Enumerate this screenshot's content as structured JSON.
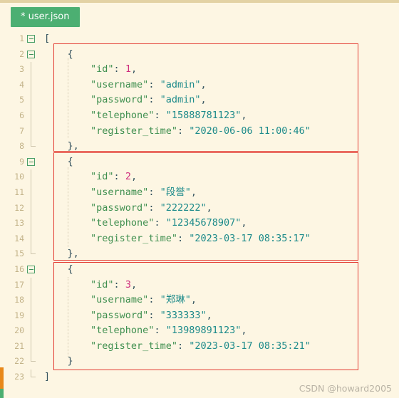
{
  "window": {
    "background_color": "#fdf6e3",
    "top_strip_color": "#e3d2a4"
  },
  "tab_bar": {
    "active_tab": {
      "label": "* user.json",
      "modified_marker": "*",
      "filename": "user.json",
      "background_color": "#4caf72",
      "text_color": "#ffffff"
    }
  },
  "editor": {
    "language": "json",
    "theme": "solarized-light",
    "colors": {
      "key": "#3f8f4f",
      "string": "#1c8a8a",
      "number": "#cf2f7e",
      "punctuation": "#34525e",
      "line_number": "#c3b389",
      "highlight_box": "#e33b32",
      "change_marker_modified": "#e8881a",
      "change_marker_added": "#4caf72"
    },
    "line_numbers": [
      "1",
      "2",
      "3",
      "4",
      "5",
      "6",
      "7",
      "8",
      "9",
      "10",
      "11",
      "12",
      "13",
      "14",
      "15",
      "16",
      "17",
      "18",
      "19",
      "20",
      "21",
      "22",
      "23"
    ],
    "fold_lines": [
      "1",
      "2",
      "9",
      "16"
    ],
    "lines": [
      {
        "n": "1",
        "indent": 0,
        "tokens": [
          {
            "t": "punc",
            "v": "["
          }
        ]
      },
      {
        "n": "2",
        "indent": 1,
        "tokens": [
          {
            "t": "punc",
            "v": "{"
          }
        ]
      },
      {
        "n": "3",
        "indent": 2,
        "tokens": [
          {
            "t": "key",
            "v": "\"id\""
          },
          {
            "t": "colon",
            "v": ": "
          },
          {
            "t": "num",
            "v": "1"
          },
          {
            "t": "punc",
            "v": ","
          }
        ]
      },
      {
        "n": "4",
        "indent": 2,
        "tokens": [
          {
            "t": "key",
            "v": "\"username\""
          },
          {
            "t": "colon",
            "v": ": "
          },
          {
            "t": "str",
            "v": "\"admin\""
          },
          {
            "t": "punc",
            "v": ","
          }
        ]
      },
      {
        "n": "5",
        "indent": 2,
        "tokens": [
          {
            "t": "key",
            "v": "\"password\""
          },
          {
            "t": "colon",
            "v": ": "
          },
          {
            "t": "str",
            "v": "\"admin\""
          },
          {
            "t": "punc",
            "v": ","
          }
        ]
      },
      {
        "n": "6",
        "indent": 2,
        "tokens": [
          {
            "t": "key",
            "v": "\"telephone\""
          },
          {
            "t": "colon",
            "v": ": "
          },
          {
            "t": "str",
            "v": "\"15888781123\""
          },
          {
            "t": "punc",
            "v": ","
          }
        ]
      },
      {
        "n": "7",
        "indent": 2,
        "tokens": [
          {
            "t": "key",
            "v": "\"register_time\""
          },
          {
            "t": "colon",
            "v": ": "
          },
          {
            "t": "str",
            "v": "\"2020-06-06 11:00:46\""
          }
        ]
      },
      {
        "n": "8",
        "indent": 1,
        "tokens": [
          {
            "t": "punc",
            "v": "},"
          }
        ]
      },
      {
        "n": "9",
        "indent": 1,
        "tokens": [
          {
            "t": "punc",
            "v": "{"
          }
        ]
      },
      {
        "n": "10",
        "indent": 2,
        "tokens": [
          {
            "t": "key",
            "v": "\"id\""
          },
          {
            "t": "colon",
            "v": ": "
          },
          {
            "t": "num",
            "v": "2"
          },
          {
            "t": "punc",
            "v": ","
          }
        ]
      },
      {
        "n": "11",
        "indent": 2,
        "tokens": [
          {
            "t": "key",
            "v": "\"username\""
          },
          {
            "t": "colon",
            "v": ": "
          },
          {
            "t": "str",
            "v": "\"段誉\""
          },
          {
            "t": "punc",
            "v": ","
          }
        ]
      },
      {
        "n": "12",
        "indent": 2,
        "tokens": [
          {
            "t": "key",
            "v": "\"password\""
          },
          {
            "t": "colon",
            "v": ": "
          },
          {
            "t": "str",
            "v": "\"222222\""
          },
          {
            "t": "punc",
            "v": ","
          }
        ]
      },
      {
        "n": "13",
        "indent": 2,
        "tokens": [
          {
            "t": "key",
            "v": "\"telephone\""
          },
          {
            "t": "colon",
            "v": ": "
          },
          {
            "t": "str",
            "v": "\"12345678907\""
          },
          {
            "t": "punc",
            "v": ","
          }
        ]
      },
      {
        "n": "14",
        "indent": 2,
        "tokens": [
          {
            "t": "key",
            "v": "\"register_time\""
          },
          {
            "t": "colon",
            "v": ": "
          },
          {
            "t": "str",
            "v": "\"2023-03-17 08:35:17\""
          }
        ]
      },
      {
        "n": "15",
        "indent": 1,
        "tokens": [
          {
            "t": "punc",
            "v": "},"
          }
        ]
      },
      {
        "n": "16",
        "indent": 1,
        "tokens": [
          {
            "t": "punc",
            "v": "{"
          }
        ]
      },
      {
        "n": "17",
        "indent": 2,
        "tokens": [
          {
            "t": "key",
            "v": "\"id\""
          },
          {
            "t": "colon",
            "v": ": "
          },
          {
            "t": "num",
            "v": "3"
          },
          {
            "t": "punc",
            "v": ","
          }
        ]
      },
      {
        "n": "18",
        "indent": 2,
        "tokens": [
          {
            "t": "key",
            "v": "\"username\""
          },
          {
            "t": "colon",
            "v": ": "
          },
          {
            "t": "str",
            "v": "\"郑琳\""
          },
          {
            "t": "punc",
            "v": ","
          }
        ]
      },
      {
        "n": "19",
        "indent": 2,
        "tokens": [
          {
            "t": "key",
            "v": "\"password\""
          },
          {
            "t": "colon",
            "v": ": "
          },
          {
            "t": "str",
            "v": "\"333333\""
          },
          {
            "t": "punc",
            "v": ","
          }
        ]
      },
      {
        "n": "20",
        "indent": 2,
        "tokens": [
          {
            "t": "key",
            "v": "\"telephone\""
          },
          {
            "t": "colon",
            "v": ": "
          },
          {
            "t": "str",
            "v": "\"13989891123\""
          },
          {
            "t": "punc",
            "v": ","
          }
        ]
      },
      {
        "n": "21",
        "indent": 2,
        "tokens": [
          {
            "t": "key",
            "v": "\"register_time\""
          },
          {
            "t": "colon",
            "v": ": "
          },
          {
            "t": "str",
            "v": "\"2023-03-17 08:35:21\""
          }
        ]
      },
      {
        "n": "22",
        "indent": 1,
        "tokens": [
          {
            "t": "punc",
            "v": "}"
          }
        ]
      },
      {
        "n": "23",
        "indent": 0,
        "tokens": [
          {
            "t": "punc",
            "v": "]"
          }
        ]
      }
    ],
    "highlight_boxes": [
      {
        "label": "record-1-highlight",
        "start_line": "2",
        "end_line": "8"
      },
      {
        "label": "record-2-highlight",
        "start_line": "9",
        "end_line": "15"
      },
      {
        "label": "record-3-highlight",
        "start_line": "16",
        "end_line": "22"
      }
    ],
    "json_records": [
      {
        "id": 1,
        "username": "admin",
        "password": "admin",
        "telephone": "15888781123",
        "register_time": "2020-06-06 11:00:46"
      },
      {
        "id": 2,
        "username": "段誉",
        "password": "222222",
        "telephone": "12345678907",
        "register_time": "2023-03-17 08:35:17"
      },
      {
        "id": 3,
        "username": "郑琳",
        "password": "333333",
        "telephone": "13989891123",
        "register_time": "2023-03-17 08:35:21"
      }
    ]
  },
  "watermark": {
    "text": "CSDN @howard2005"
  }
}
